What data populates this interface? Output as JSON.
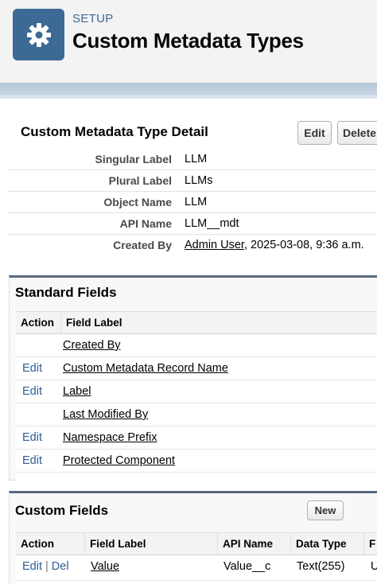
{
  "header": {
    "eyebrow": "SETUP",
    "title": "Custom Metadata Types",
    "icon": "gear-icon",
    "icon_color": "#3c6a95"
  },
  "detail": {
    "title": "Custom Metadata Type Detail",
    "edit_label": "Edit",
    "delete_label": "Delete",
    "rows": [
      {
        "label": "Singular Label",
        "value": "LLM"
      },
      {
        "label": "Plural Label",
        "value": "LLMs"
      },
      {
        "label": "Object Name",
        "value": "LLM"
      },
      {
        "label": "API Name",
        "value": "LLM__mdt"
      },
      {
        "label": "Created By",
        "user": "Admin User",
        "date": ", 2025-03-08, 9:36 a.m."
      }
    ]
  },
  "standard_fields": {
    "title": "Standard Fields",
    "columns": [
      "Action",
      "Field Label"
    ],
    "rows": [
      {
        "action": "",
        "label": "Created By"
      },
      {
        "action": "Edit",
        "label": "Custom Metadata Record Name"
      },
      {
        "action": "Edit",
        "label": "Label"
      },
      {
        "action": "",
        "label": "Last Modified By"
      },
      {
        "action": "Edit",
        "label": "Namespace Prefix"
      },
      {
        "action": "Edit",
        "label": "Protected Component"
      }
    ]
  },
  "custom_fields": {
    "title": "Custom Fields",
    "new_label": "New",
    "columns": [
      "Action",
      "Field Label",
      "API Name",
      "Data Type",
      "F"
    ],
    "rows": [
      {
        "edit": "Edit",
        "sep": "|",
        "del": "Del",
        "label": "Value",
        "api": "Value__c",
        "type": "Text(255)",
        "extra": "U"
      }
    ]
  }
}
